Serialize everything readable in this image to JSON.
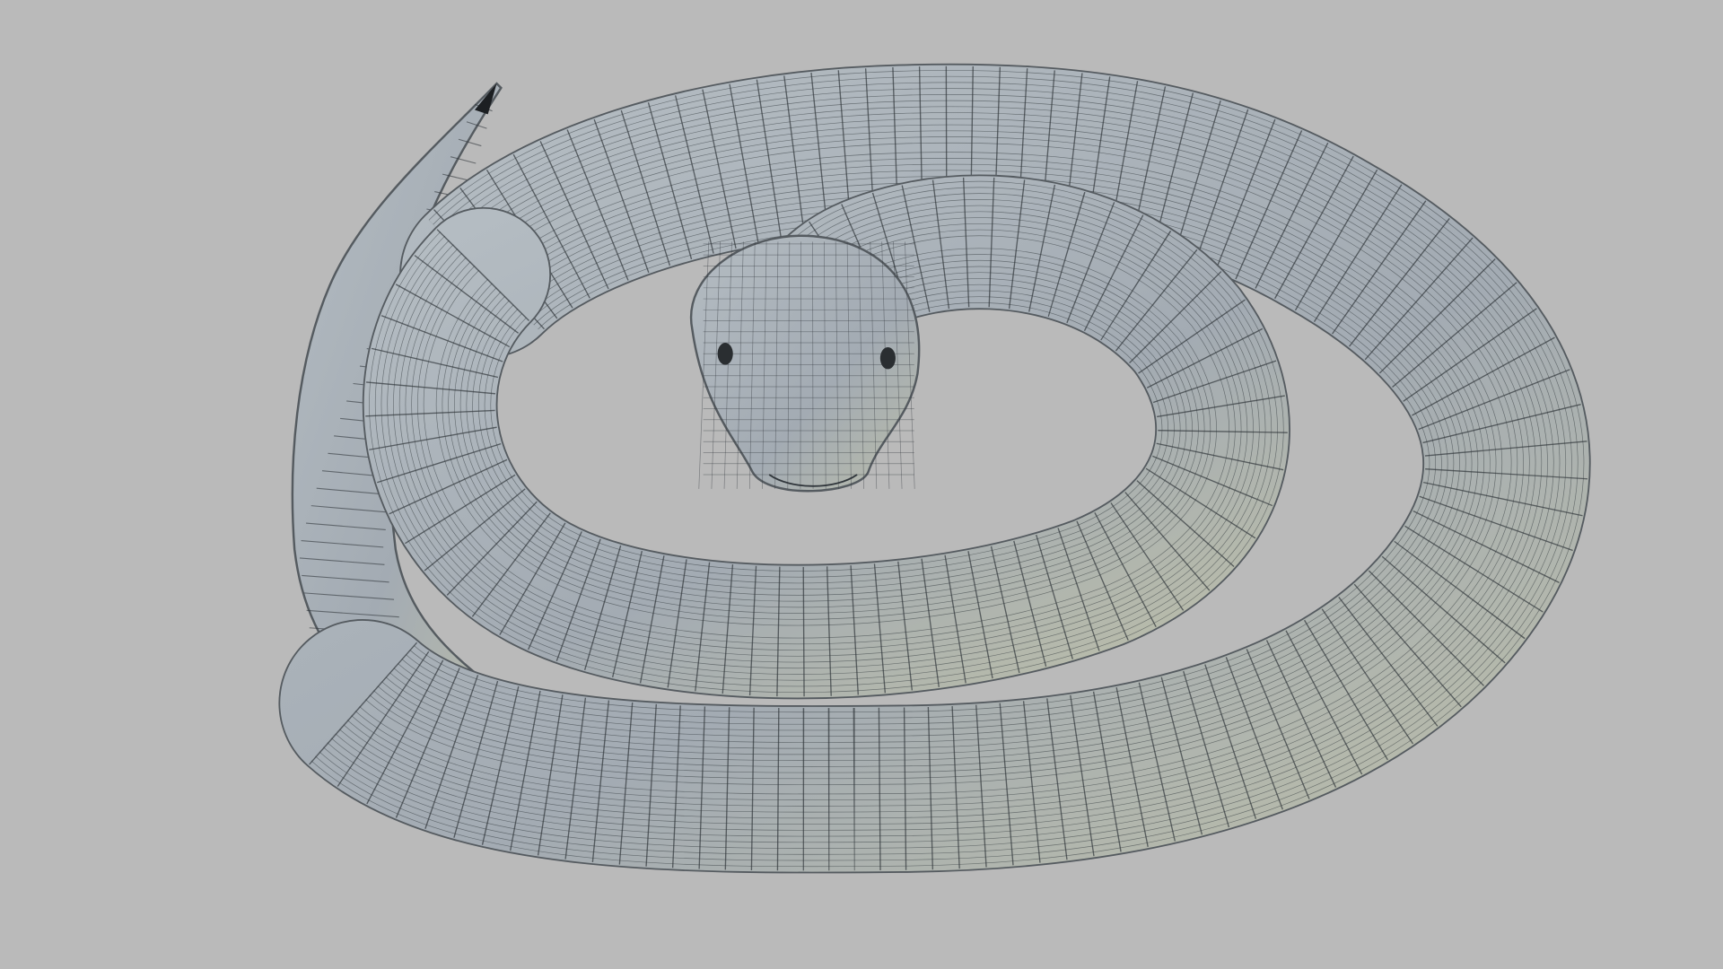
{
  "colors": {
    "background": "#bababa",
    "body": "#a8b0b7",
    "body_highlight": "#c3c9cc",
    "wire": "#30363b",
    "tail_tip": "#1c1f22",
    "eye": "#2a2e31"
  }
}
